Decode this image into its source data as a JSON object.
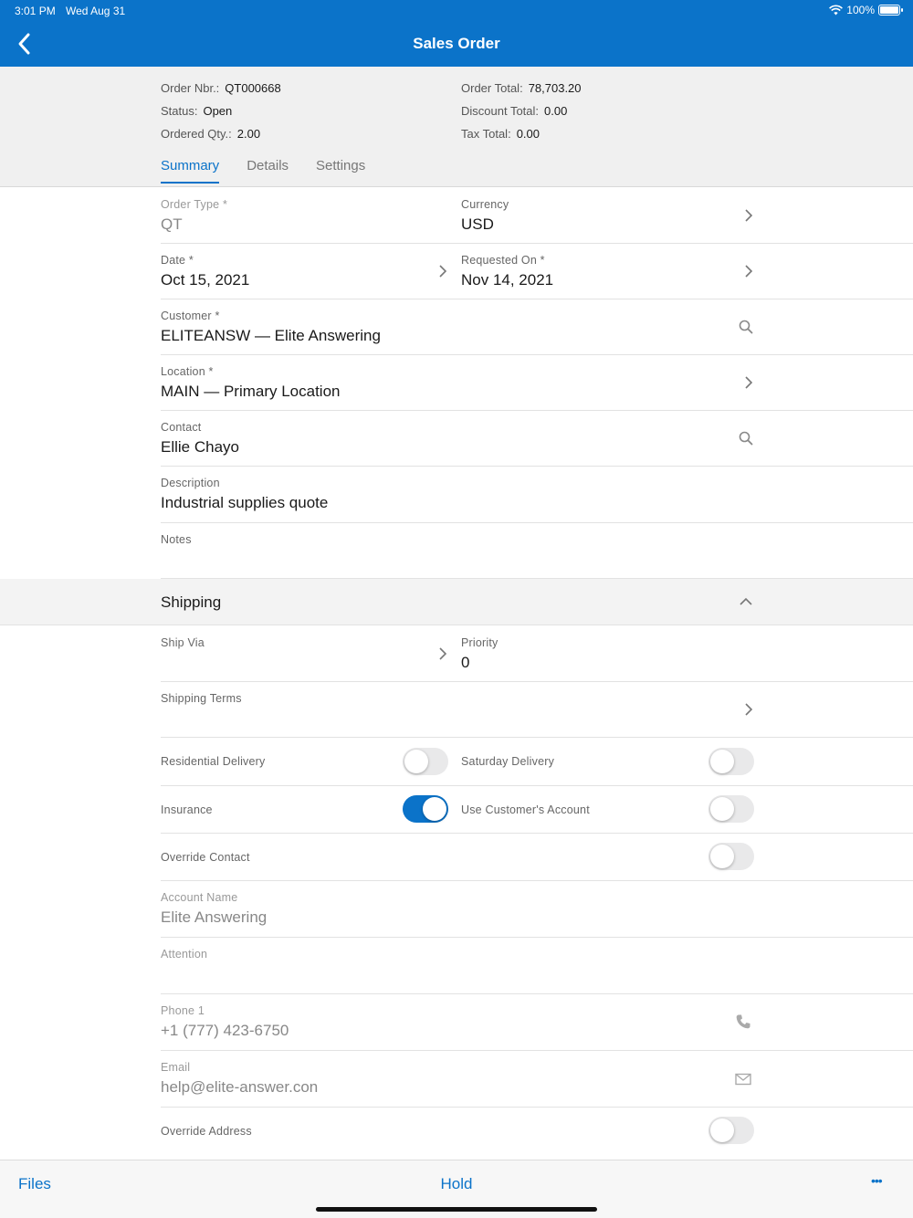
{
  "status_bar": {
    "time": "3:01 PM",
    "date": "Wed Aug 31",
    "battery": "100%"
  },
  "header": {
    "title": "Sales Order"
  },
  "summary": {
    "order_nbr_label": "Order Nbr.:",
    "order_nbr": "QT000668",
    "status_label": "Status:",
    "status": "Open",
    "ordered_qty_label": "Ordered Qty.:",
    "ordered_qty": "2.00",
    "order_total_label": "Order Total:",
    "order_total": "78,703.20",
    "discount_total_label": "Discount Total:",
    "discount_total": "0.00",
    "tax_total_label": "Tax Total:",
    "tax_total": "0.00"
  },
  "tabs": [
    {
      "label": "Summary",
      "active": true
    },
    {
      "label": "Details",
      "active": false
    },
    {
      "label": "Settings",
      "active": false
    }
  ],
  "form": {
    "order_type": {
      "label": "Order Type *",
      "value": "QT"
    },
    "currency": {
      "label": "Currency",
      "value": "USD"
    },
    "date": {
      "label": "Date *",
      "value": "Oct 15, 2021"
    },
    "requested_on": {
      "label": "Requested On *",
      "value": "Nov 14, 2021"
    },
    "customer": {
      "label": "Customer *",
      "value": "ELITEANSW — Elite Answering"
    },
    "location": {
      "label": "Location *",
      "value": "MAIN — Primary Location"
    },
    "contact": {
      "label": "Contact",
      "value": "Ellie Chayo"
    },
    "description": {
      "label": "Description",
      "value": "Industrial supplies quote"
    },
    "notes": {
      "label": "Notes",
      "value": ""
    }
  },
  "shipping": {
    "title": "Shipping",
    "ship_via": {
      "label": "Ship Via",
      "value": ""
    },
    "priority": {
      "label": "Priority",
      "value": "0"
    },
    "shipping_terms": {
      "label": "Shipping Terms",
      "value": ""
    },
    "residential_delivery": {
      "label": "Residential Delivery",
      "on": false
    },
    "saturday_delivery": {
      "label": "Saturday Delivery",
      "on": false
    },
    "insurance": {
      "label": "Insurance",
      "on": true
    },
    "use_customers_account": {
      "label": "Use Customer's Account",
      "on": false
    },
    "override_contact": {
      "label": "Override Contact",
      "on": false
    },
    "account_name": {
      "label": "Account Name",
      "value": "Elite Answering"
    },
    "attention": {
      "label": "Attention",
      "value": ""
    },
    "phone1": {
      "label": "Phone 1",
      "value": "+1 (777) 423-6750"
    },
    "email": {
      "label": "Email",
      "value": "help@elite-answer.con"
    },
    "override_address": {
      "label": "Override Address",
      "on": false
    }
  },
  "toolbar": {
    "files": "Files",
    "hold": "Hold",
    "more": "•••"
  },
  "colors": {
    "accent": "#0b73c9",
    "header_bg": "#0b73c9",
    "summary_bg": "#f0f0f0"
  },
  "icons": [
    "back-chevron-icon",
    "chevron-right-icon",
    "search-icon",
    "chevron-up-icon",
    "phone-icon",
    "mail-icon",
    "wifi-icon",
    "battery-icon",
    "more-icon"
  ]
}
